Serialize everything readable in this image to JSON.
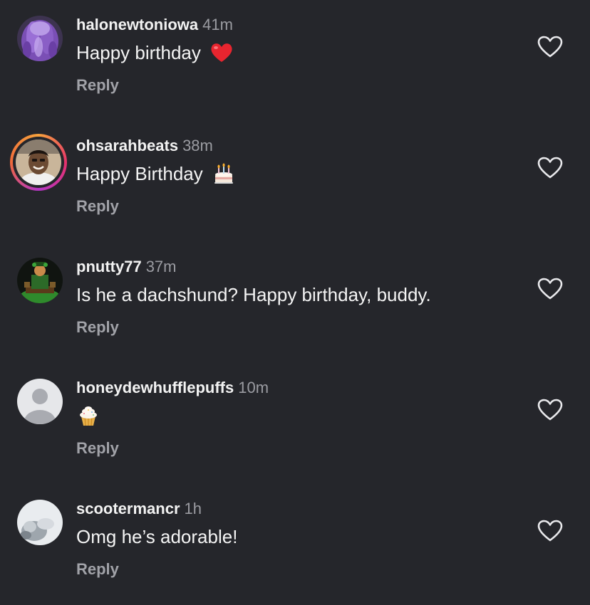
{
  "colors": {
    "background": "#25262b",
    "text_primary": "#f2f2f2",
    "text_secondary": "#9b9ca2",
    "story_ring": "#e6326b"
  },
  "comments": [
    {
      "username": "halonewtoniowa",
      "time": "41m",
      "text": "Happy birthday",
      "emoji": "red-heart-icon",
      "reply_label": "Reply",
      "avatar": "purple-hair-avatar"
    },
    {
      "username": "ohsarahbeats",
      "time": "38m",
      "text": "Happy Birthday",
      "emoji": "birthday-cake-icon",
      "reply_label": "Reply",
      "avatar": "person-photo-avatar",
      "has_story_ring": true
    },
    {
      "username": "pnutty77",
      "time": "37m",
      "text": "Is he a dachshund? Happy birthday, buddy.",
      "reply_label": "Reply",
      "avatar": "green-figure-avatar"
    },
    {
      "username": "honeydewhufflepuffs",
      "time": "10m",
      "text": "",
      "emoji": "cupcake-icon",
      "reply_label": "Reply",
      "avatar": "default-person-avatar"
    },
    {
      "username": "scootermancr",
      "time": "1h",
      "text": "Omg he’s adorable!",
      "reply_label": "Reply",
      "avatar": "blurred-photo-avatar"
    }
  ]
}
